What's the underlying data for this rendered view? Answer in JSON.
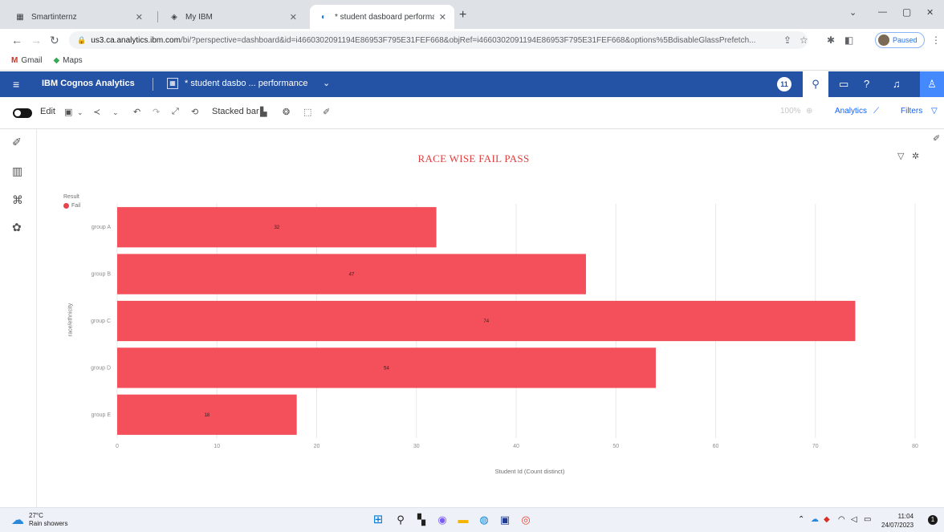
{
  "browser": {
    "tabs": [
      {
        "label": "Smartinternz",
        "icon": "▦"
      },
      {
        "label": "My IBM",
        "icon": "◈"
      },
      {
        "label": "* student dasboard performance",
        "icon": "◐"
      }
    ],
    "new_tab": "+",
    "window_controls": {
      "minimize": "—",
      "maximize": "▢",
      "close": "✕",
      "dropdown": "⌄"
    },
    "url_host": "us3.ca.analytics.ibm.com",
    "url_path": "/bi/?perspective=dashboard&id=i4660302091194E86953F795E31FEF668&objRef=i4660302091194E86953F795E31FEF668&options%5BdisableGlassPrefetch...",
    "profile_status": "Paused"
  },
  "bookmarks": [
    {
      "label": "Gmail",
      "icon": "M"
    },
    {
      "label": "Maps",
      "icon": "◆"
    }
  ],
  "app": {
    "brand": "IBM Cognos Analytics",
    "dashboard_title": "* student dasbo ... performance",
    "notification_count": "11"
  },
  "toolbar": {
    "edit_label": "Edit",
    "visualization_label": "Stacked bar",
    "zoom_label": "100%",
    "analytics_label": "Analytics",
    "filters_label": "Filters"
  },
  "colors": {
    "appbar": "#2452a5",
    "bar": "#f4505b",
    "title": "#e0403f"
  },
  "chart_data": {
    "type": "bar",
    "orientation": "horizontal",
    "title": "RACE WISE FAIL PASS",
    "legend_title": "Result",
    "legend_placement": "top-left",
    "categories": [
      "group A",
      "group B",
      "group C",
      "group D",
      "group E"
    ],
    "series": [
      {
        "name": "Fail",
        "values": [
          32,
          47,
          74,
          54,
          18
        ]
      }
    ],
    "xlabel": "Student Id (Count distinct)",
    "ylabel": "race/ethnicity",
    "xlim": [
      0,
      80
    ],
    "xticks": [
      0,
      10,
      20,
      30,
      40,
      50,
      60,
      70,
      80
    ],
    "grid": true
  },
  "taskbar": {
    "temperature": "27°C",
    "weather_text": "Rain showers",
    "time": "11:04",
    "date": "24/07/2023"
  }
}
